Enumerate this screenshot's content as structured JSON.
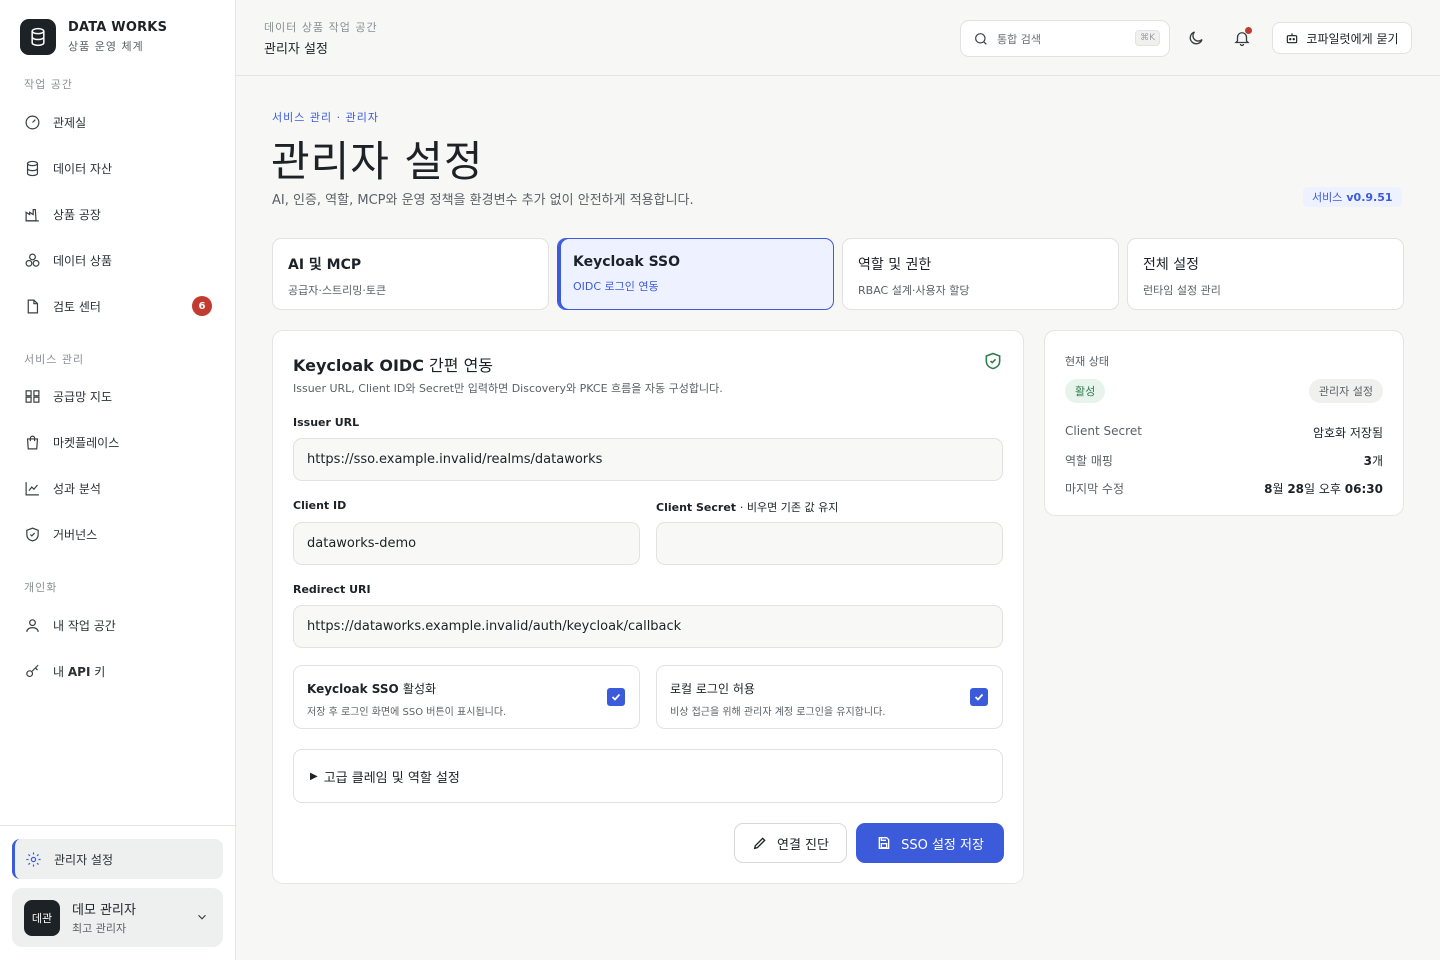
{
  "brand": {
    "title": "DATA WORKS",
    "subtitle": "상품 운영 체계"
  },
  "sidebar": {
    "sections": [
      {
        "label": "작업 공간"
      },
      {
        "label": "서비스 관리"
      },
      {
        "label": "개인화"
      }
    ],
    "items": [
      {
        "label": "관제실"
      },
      {
        "label": "데이터 자산"
      },
      {
        "label": "상품 공장"
      },
      {
        "label": "데이터 상품"
      },
      {
        "label": "검토 센터",
        "badge": "6"
      },
      {
        "label": "공급망 지도"
      },
      {
        "label": "마켓플레이스"
      },
      {
        "label": "성과 분석"
      },
      {
        "label": "거버넌스"
      },
      {
        "label": "내 작업 공간"
      },
      {
        "api": "API",
        "rest": "키",
        "prefix": "내 "
      }
    ],
    "active_item": {
      "label": "관리자 설정"
    },
    "user": {
      "avatar": "데관",
      "name": "데모 관리자",
      "role": "최고 관리자"
    }
  },
  "header": {
    "breadcrumb": "데이터 상품 작업 공간",
    "title": "관리자 설정",
    "search_placeholder": "통합 검색",
    "search_shortcut": "⌘K",
    "ask_label": "코파일럿에게 묻기"
  },
  "page": {
    "eyebrow": "서비스 관리 · 관리자",
    "title": "관리자 설정",
    "description": "AI, 인증, 역할, MCP와 운영 정책을 환경변수 추가 없이 안전하게 적용합니다.",
    "version_prefix": "서비스",
    "version": "v0.9.51"
  },
  "tabs": [
    {
      "title": "AI 및 MCP",
      "subtitle": "공급자·스트리밍·토큰"
    },
    {
      "title": "Keycloak SSO",
      "subtitle": "OIDC 로그인 연동"
    },
    {
      "title": "역할 및 권한",
      "subtitle": "RBAC 설계·사용자 할당"
    },
    {
      "title": "전체 설정",
      "subtitle": "런타임 설정 관리"
    }
  ],
  "form": {
    "title_bold": "Keycloak OIDC",
    "title_rest": "간편 연동",
    "description": "Issuer URL, Client ID와 Secret만 입력하면 Discovery와 PKCE 흐름을 자동 구성합니다.",
    "issuer_label": "Issuer URL",
    "issuer_value": "https://sso.example.invalid/realms/dataworks",
    "client_id_label": "Client ID",
    "client_id_value": "dataworks-demo",
    "client_secret_label": "Client Secret",
    "client_secret_hint": "· 비우면 기존 값 유지",
    "client_secret_value": "",
    "redirect_label": "Redirect URI",
    "redirect_value": "https://dataworks.example.invalid/auth/keycloak/callback",
    "sso_enable": {
      "title_bold": "Keycloak SSO",
      "title_rest": "활성화",
      "desc": "저장 후 로그인 화면에 SSO 버튼이 표시됩니다.",
      "checked": true
    },
    "local_login": {
      "title": "로컬 로그인 허용",
      "desc": "비상 접근을 위해 관리자 계정 로그인을 유지합니다.",
      "checked": true
    },
    "advanced_label": "고급 클레임 및 역할 설정",
    "diagnose_label": "연결 진단",
    "save_label": "SSO 설정 저장"
  },
  "status": {
    "label": "현재 상태",
    "state": "활성",
    "tag": "관리자 설정",
    "rows": [
      {
        "key": "Client Secret",
        "value": "암호화 저장됨"
      },
      {
        "key": "역할 매핑",
        "value_num": "3",
        "value_unit": "개"
      },
      {
        "key": "마지막 수정",
        "month": "8",
        "month_unit": "월",
        "day": "28",
        "day_unit": "일 오후",
        "time": "06:30"
      }
    ]
  },
  "colors": {
    "accent": "#3b5bdb",
    "badge": "#c23b31",
    "success": "#2f7a4e"
  }
}
